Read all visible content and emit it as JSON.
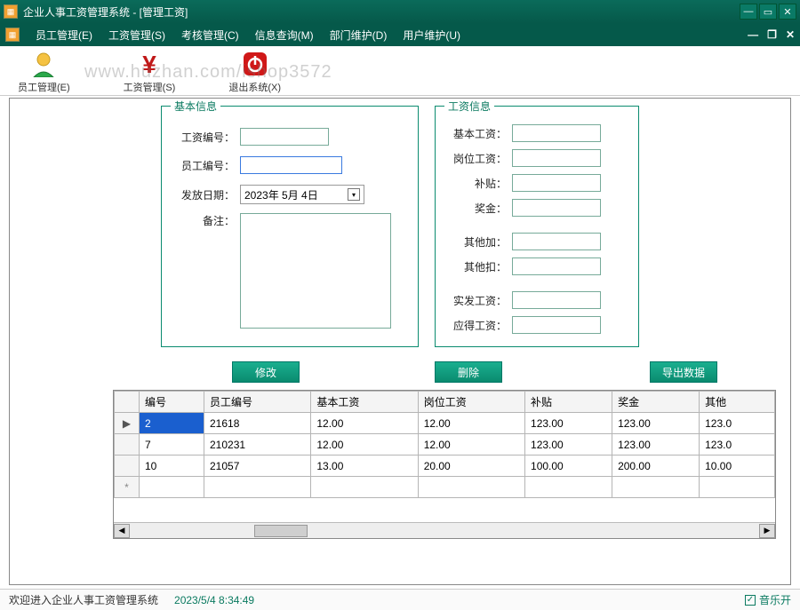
{
  "window": {
    "title": "企业人事工资管理系统 - [管理工资]"
  },
  "menu": {
    "items": [
      "员工管理(E)",
      "工资管理(S)",
      "考核管理(C)",
      "信息查询(M)",
      "部门维护(D)",
      "用户维护(U)"
    ]
  },
  "toolbar": {
    "items": [
      {
        "label": "员工管理(E)",
        "icon": "person"
      },
      {
        "label": "工资管理(S)",
        "icon": "yen"
      },
      {
        "label": "退出系统(X)",
        "icon": "power"
      }
    ]
  },
  "watermark": "www.huzhan.com/ishop3572",
  "groups": {
    "basic": {
      "legend": "基本信息",
      "fields": {
        "salary_id": {
          "label": "工资编号：",
          "value": ""
        },
        "emp_id": {
          "label": "员工编号：",
          "value": ""
        },
        "pay_date": {
          "label": "发放日期：",
          "value": "2023年 5月 4日"
        },
        "remark": {
          "label": "备注：",
          "value": ""
        }
      }
    },
    "salary": {
      "legend": "工资信息",
      "fields": {
        "base": {
          "label": "基本工资：",
          "value": ""
        },
        "post": {
          "label": "岗位工资：",
          "value": ""
        },
        "subsidy": {
          "label": "补贴：",
          "value": ""
        },
        "bonus": {
          "label": "奖金：",
          "value": ""
        },
        "other_add": {
          "label": "其他加：",
          "value": ""
        },
        "other_ded": {
          "label": "其他扣：",
          "value": ""
        },
        "net": {
          "label": "实发工资：",
          "value": ""
        },
        "should": {
          "label": "应得工资：",
          "value": ""
        }
      }
    }
  },
  "buttons": {
    "edit": "修改",
    "delete": "删除",
    "export": "导出数据"
  },
  "grid": {
    "columns": [
      "编号",
      "员工编号",
      "基本工资",
      "岗位工资",
      "补贴",
      "奖金",
      "其他"
    ],
    "rows": [
      {
        "indicator": "▶",
        "cells": [
          "2",
          "21618",
          "12.00",
          "12.00",
          "123.00",
          "123.00",
          "123.0"
        ],
        "selected_col": 0
      },
      {
        "indicator": "",
        "cells": [
          "7",
          "210231",
          "12.00",
          "12.00",
          "123.00",
          "123.00",
          "123.0"
        ]
      },
      {
        "indicator": "",
        "cells": [
          "10",
          "21057",
          "13.00",
          "20.00",
          "100.00",
          "200.00",
          "10.00"
        ]
      }
    ],
    "new_row_indicator": "*"
  },
  "status": {
    "welcome": "欢迎进入企业人事工资管理系统",
    "time": "2023/5/4 8:34:49",
    "music": "音乐开"
  }
}
